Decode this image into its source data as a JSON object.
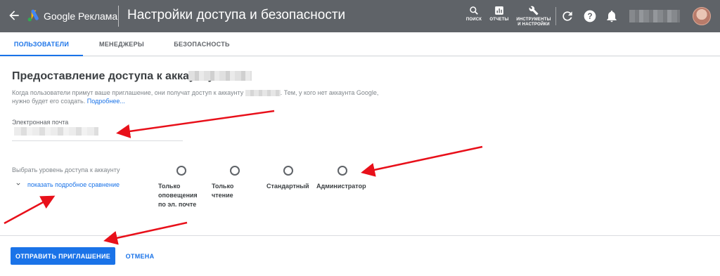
{
  "header": {
    "product": "Google Реклама",
    "title": "Настройки доступа и безопасности",
    "tools": {
      "search": "ПОИСК",
      "reports": "ОТЧЕТЫ",
      "settings_line1": "ИНСТРУМЕНТЫ",
      "settings_line2": "И НАСТРОЙКИ"
    },
    "icons": [
      "arrow-back-icon",
      "google-ads-logo",
      "search-icon",
      "reports-icon",
      "wrench-icon",
      "refresh-icon",
      "help-icon",
      "bell-icon",
      "avatar"
    ]
  },
  "tabs": [
    {
      "label": "ПОЛЬЗОВАТЕЛИ",
      "active": true
    },
    {
      "label": "МЕНЕДЖЕРЫ",
      "active": false
    },
    {
      "label": "БЕЗОПАСНОСТЬ",
      "active": false
    }
  ],
  "main": {
    "heading": "Предоставление доступа к аккаунту",
    "desc_part1": "Когда пользователи примут ваше приглашение, они получат доступ к аккаунту",
    "desc_part2": ". Тем, у кого нет аккаунта Google,",
    "desc_part3": "нужно будет его создать.",
    "desc_link": "Подробнее...",
    "email_label": "Электронная почта",
    "access_level_label": "Выбрать уровень доступа к аккаунту",
    "compare_link": "показать подробное сравнение",
    "options": [
      {
        "line1": "Только",
        "line2": "оповещения",
        "line3": "по эл. почте"
      },
      {
        "line1": "Только",
        "line2": "чтение"
      },
      {
        "line1": "Стандартный"
      },
      {
        "line1": "Администратор"
      }
    ]
  },
  "footer": {
    "send": "ОТПРАВИТЬ ПРИГЛАШЕНИЕ",
    "cancel": "ОТМЕНА"
  },
  "colors": {
    "topbar": "#5f6368",
    "accent": "#1a73e8",
    "annotation": "#e8101a"
  }
}
